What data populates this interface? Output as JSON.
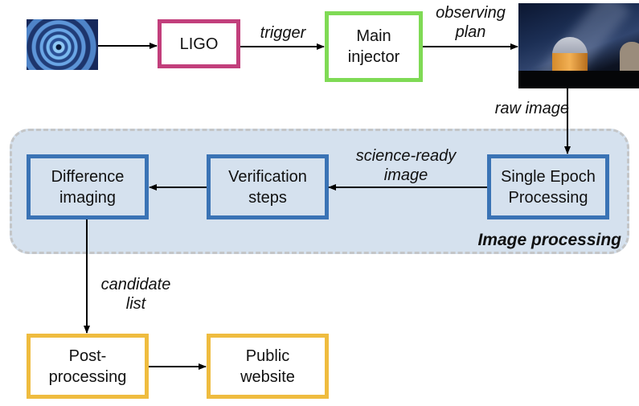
{
  "diagram": {
    "nodes": [
      {
        "id": "gw-image",
        "kind": "image",
        "icon": "gravitational-wave-spiral-image"
      },
      {
        "id": "ligo",
        "label_lines": [
          "LIGO"
        ],
        "border_color": "#c23f7c"
      },
      {
        "id": "main-injector",
        "label_lines": [
          "Main",
          "injector"
        ],
        "border_color": "#7fda55"
      },
      {
        "id": "telescope-image",
        "kind": "image",
        "icon": "observatory-telescope-photo"
      },
      {
        "id": "single-epoch",
        "label_lines": [
          "Single Epoch",
          "Processing"
        ],
        "border_color": "#3a73b5"
      },
      {
        "id": "verification",
        "label_lines": [
          "Verification",
          "steps"
        ],
        "border_color": "#3a73b5"
      },
      {
        "id": "difference",
        "label_lines": [
          "Difference",
          "imaging"
        ],
        "border_color": "#3a73b5"
      },
      {
        "id": "post-processing",
        "label_lines": [
          "Post-",
          "processing"
        ],
        "border_color": "#efbc3f"
      },
      {
        "id": "public-website",
        "label_lines": [
          "Public",
          "website"
        ],
        "border_color": "#efbc3f"
      }
    ],
    "edges": [
      {
        "from": "gw-image",
        "to": "ligo",
        "label_lines": []
      },
      {
        "from": "ligo",
        "to": "main-injector",
        "label_lines": [
          "trigger"
        ]
      },
      {
        "from": "main-injector",
        "to": "telescope-image",
        "label_lines": [
          "observing",
          "plan"
        ]
      },
      {
        "from": "telescope-image",
        "to": "single-epoch",
        "label_lines": [
          "raw image"
        ]
      },
      {
        "from": "single-epoch",
        "to": "verification",
        "label_lines": [
          "science-ready",
          "image"
        ]
      },
      {
        "from": "verification",
        "to": "difference",
        "label_lines": []
      },
      {
        "from": "difference",
        "to": "post-processing",
        "label_lines": [
          "candidate",
          "list"
        ]
      },
      {
        "from": "post-processing",
        "to": "public-website",
        "label_lines": []
      }
    ],
    "group": {
      "label": "Image processing",
      "background": "#d5e1ee",
      "border_color": "#c4c6c8"
    }
  }
}
